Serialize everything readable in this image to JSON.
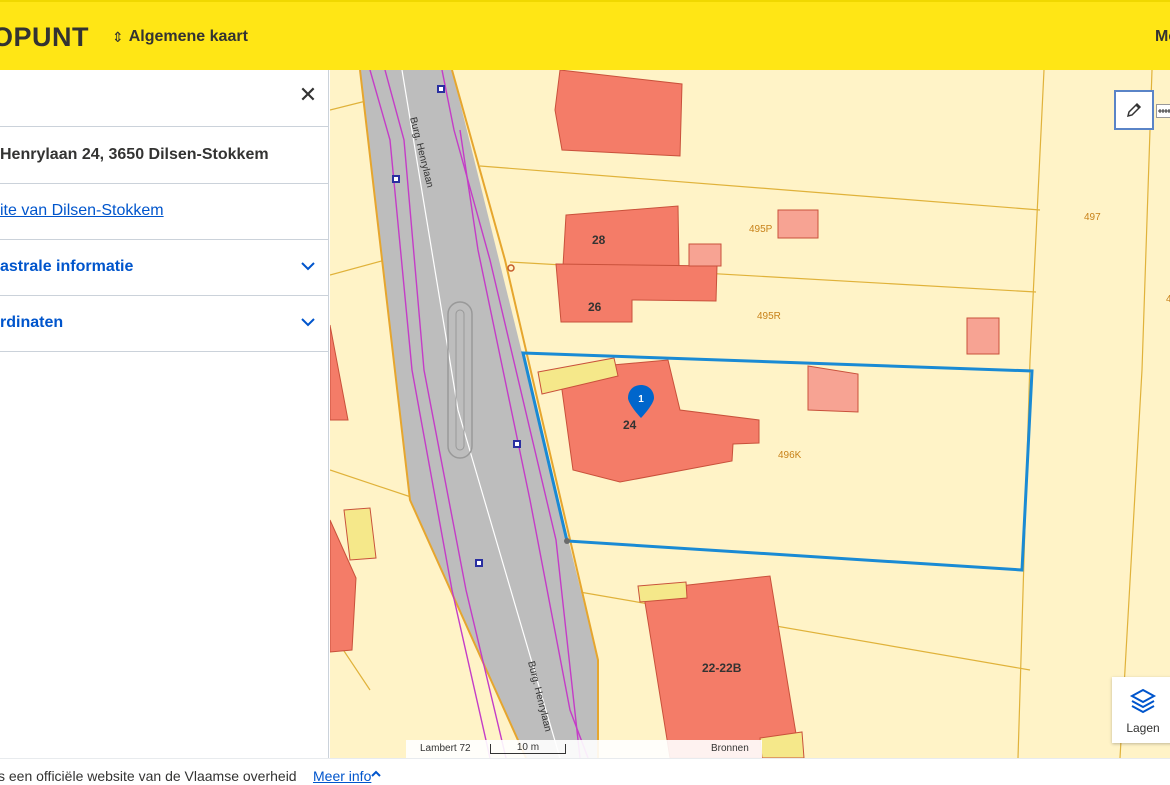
{
  "header": {
    "brand": "OPUNT",
    "map_select_icon": "updown-arrows-icon",
    "map_select_label": "Algemene kaart",
    "menu_label": "Me"
  },
  "sidebar": {
    "close_icon": "close-icon",
    "address": "Henrylaan 24, 3650 Dilsen-Stokkem",
    "site_link": "ite van Dilsen-Stokkem",
    "accordions": [
      {
        "label": "astrale informatie",
        "icon": "chevron-down-icon"
      },
      {
        "label": "rdinaten",
        "icon": "chevron-down-icon"
      }
    ]
  },
  "map": {
    "street_labels": [
      "Burg. Henrylaan",
      "Burg. Henrylaan"
    ],
    "house_numbers": [
      "28",
      "26",
      "24",
      "22-22B"
    ],
    "parcel_labels": [
      "495P",
      "497",
      "495R",
      "496K",
      "4"
    ],
    "marker_number": "1",
    "crs_label": "Lambert 72",
    "scale_label": "10 m",
    "sources_label": "Bronnen",
    "layers_label": "Lagen",
    "edit_icon": "pencil-icon",
    "ruler_icon": "ruler-icon",
    "layers_icon": "layers-icon",
    "colors": {
      "background": "#fff3c7",
      "building": "#f47c68",
      "road": "#bdbdbd",
      "selected_parcel": "#1a8ad4",
      "marker": "#0066cc"
    }
  },
  "footer": {
    "text": "s een officiële website van de Vlaamse overheid",
    "link": "Meer info",
    "caret_icon": "caret-up-icon"
  }
}
